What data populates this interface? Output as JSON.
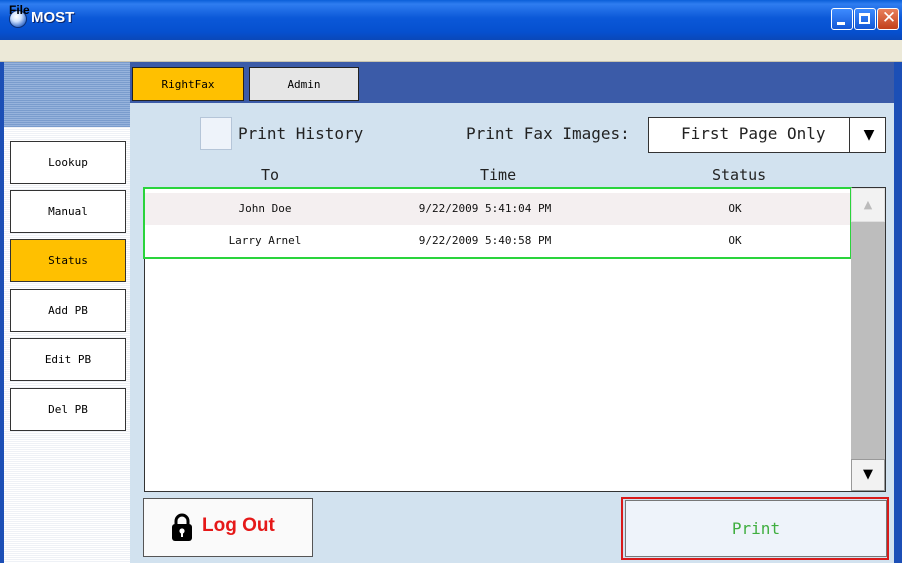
{
  "window": {
    "title": "MOST",
    "controls": {
      "minimize": "minimize",
      "maximize": "maximize",
      "close": "✕"
    }
  },
  "menu": {
    "items": [
      "File"
    ]
  },
  "tabs": [
    {
      "label": "RightFax",
      "active": true
    },
    {
      "label": "Admin",
      "active": false
    }
  ],
  "sidebar": {
    "items": [
      {
        "label": "Lookup",
        "active": false
      },
      {
        "label": "Manual",
        "active": false
      },
      {
        "label": "Status",
        "active": true
      },
      {
        "label": "Add PB",
        "active": false
      },
      {
        "label": "Edit PB",
        "active": false
      },
      {
        "label": "Del PB",
        "active": false
      }
    ]
  },
  "options": {
    "print_history_label": "Print History",
    "print_history_checked": false,
    "print_fax_images_label": "Print Fax Images:",
    "print_fax_images_value": "First Page Only"
  },
  "table": {
    "columns": [
      "To",
      "Time",
      "Status"
    ],
    "rows": [
      {
        "to": "John Doe",
        "time": "9/22/2009 5:41:04 PM",
        "status": "OK"
      },
      {
        "to": "Larry Arnel",
        "time": "9/22/2009 5:40:58 PM",
        "status": "OK"
      }
    ]
  },
  "buttons": {
    "logout": "Log Out",
    "print": "Print"
  },
  "colors": {
    "titlebar": "#0a5fd8",
    "accent_yellow": "#ffc000",
    "content_bg": "#d2e2ef",
    "selection_outline": "#2ad43c",
    "print_outline": "#d81a1a",
    "logout_text": "#e51818",
    "print_text": "#3fae3f"
  },
  "icons": {
    "app": "globe-icon",
    "lock": "lock-icon",
    "dropdown": "chevron-down-icon",
    "scroll_up": "arrow-up-icon",
    "scroll_down": "arrow-down-icon"
  }
}
